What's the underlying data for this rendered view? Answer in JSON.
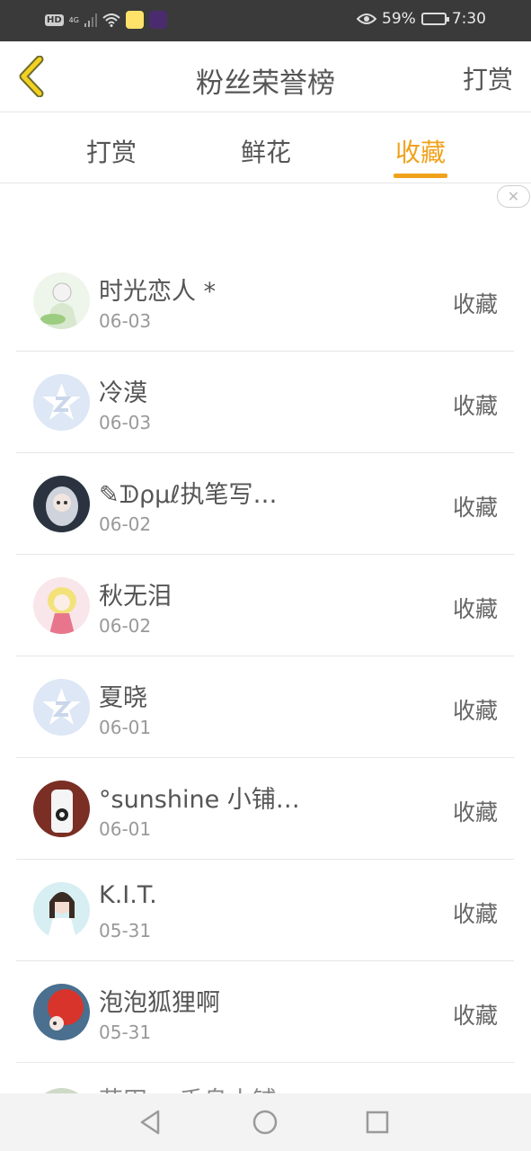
{
  "status_bar": {
    "hd": "HD",
    "network": "4G",
    "battery_percent": "59%",
    "battery_level": 0.59,
    "time": "7:30"
  },
  "header": {
    "title": "粉丝荣誉榜",
    "action": "打赏",
    "back_icon": "chevron-left-icon",
    "accent_color": "#f0a21c"
  },
  "tabs": [
    {
      "label": "打赏",
      "active": false
    },
    {
      "label": "鲜花",
      "active": false
    },
    {
      "label": "收藏",
      "active": true
    }
  ],
  "close_icon": "✕",
  "list": [
    {
      "name": "时光恋人 *",
      "date": "06-03",
      "action": "收藏",
      "avatar": "anime-girl-green"
    },
    {
      "name": "冷漠",
      "date": "06-03",
      "action": "收藏",
      "avatar": "default-star"
    },
    {
      "name": "✎ᗫρμℓ执笔写…",
      "date": "06-02",
      "action": "收藏",
      "avatar": "anime-girl-dark"
    },
    {
      "name": "秋无泪",
      "date": "06-02",
      "action": "收藏",
      "avatar": "anime-girl-pink"
    },
    {
      "name": "夏晓",
      "date": "06-01",
      "action": "收藏",
      "avatar": "default-star"
    },
    {
      "name": "°sunshine 小铺…",
      "date": "06-01",
      "action": "收藏",
      "avatar": "bottle-photo"
    },
    {
      "name": "K.I.T.",
      "date": "05-31",
      "action": "收藏",
      "avatar": "girl-photo"
    },
    {
      "name": "泡泡狐狸啊",
      "date": "05-31",
      "action": "收藏",
      "avatar": "red-fox"
    }
  ],
  "partial_row": {
    "name": "花田一 千鸟小铺"
  },
  "nav": [
    "back-triangle-icon",
    "home-circle-icon",
    "recent-square-icon"
  ]
}
